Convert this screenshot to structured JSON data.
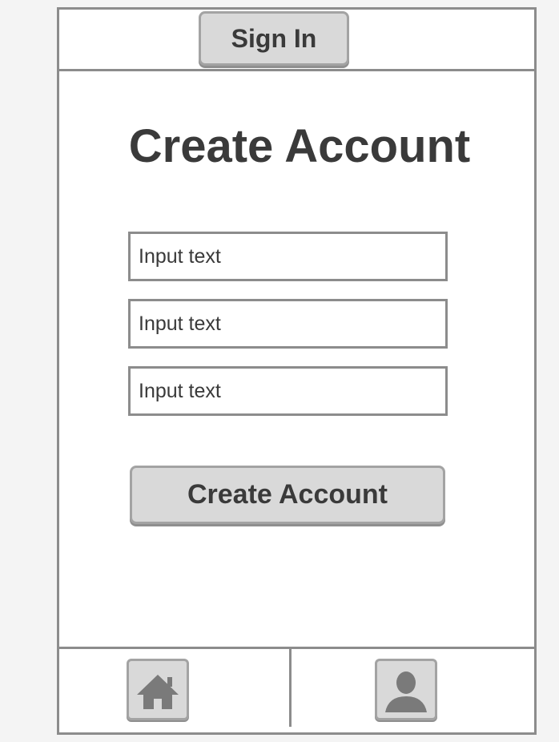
{
  "header": {
    "signin_label": "Sign In"
  },
  "main": {
    "title": "Create Account",
    "fields": [
      {
        "value": "Input text"
      },
      {
        "value": "Input text"
      },
      {
        "value": "Input text"
      }
    ],
    "submit_label": "Create Account"
  },
  "tabbar": {
    "items": [
      {
        "icon": "home-icon"
      },
      {
        "icon": "user-icon"
      }
    ]
  },
  "colors": {
    "border": "#8c8c8c",
    "button_fill": "#d9d9d9",
    "icon": "#7a7a7a",
    "text": "#3a3a3a"
  }
}
